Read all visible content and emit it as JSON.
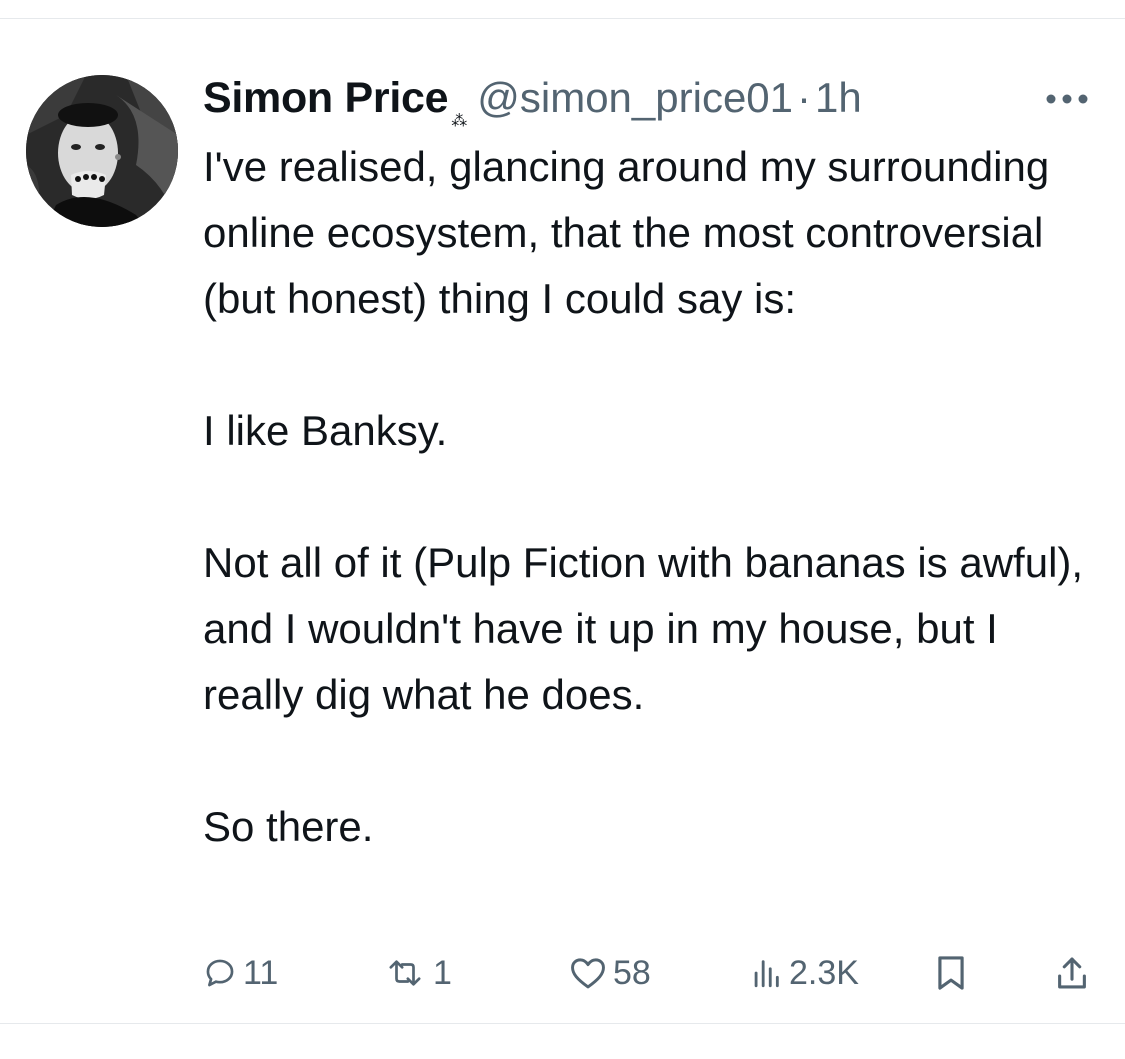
{
  "tweet": {
    "author": {
      "display_name": "Simon Price",
      "name_symbol": "⁂",
      "handle": "@simon_price01",
      "separator": "·",
      "timestamp": "1h"
    },
    "more_icon": "more-horizontal-icon",
    "text_paragraphs": [
      "I've realised, glancing around my surrounding online ecosystem, that the most controversial (but honest) thing I could say is:",
      "I like Banksy.",
      "Not all of it (Pulp Fiction with bananas is awful), and I wouldn't have it up in my house, but I really dig what he does.",
      "So there."
    ],
    "actions": {
      "reply_count": "11",
      "retweet_count": "1",
      "like_count": "58",
      "views_count": "2.3K"
    },
    "colors": {
      "text_primary": "#0f1419",
      "text_secondary": "#536471",
      "divider": "#e6e9ec"
    }
  }
}
